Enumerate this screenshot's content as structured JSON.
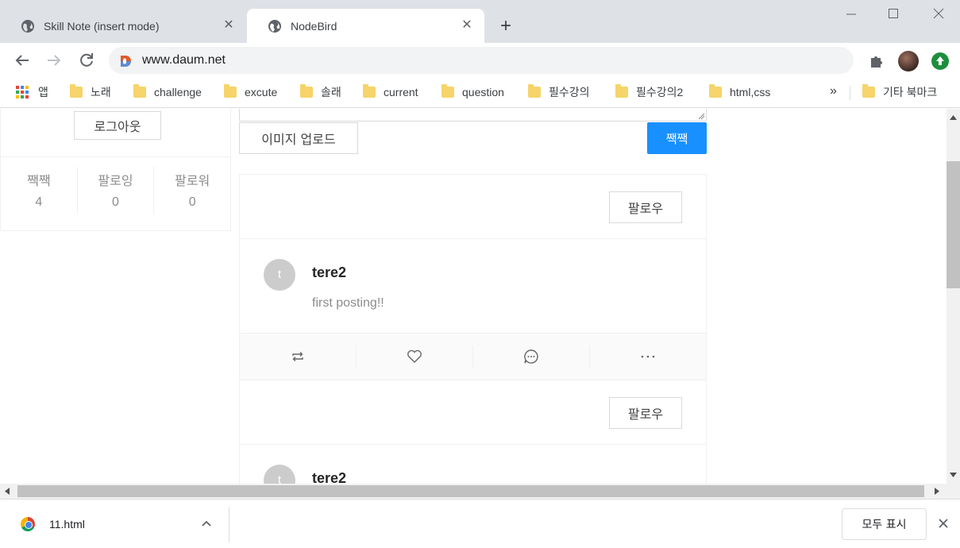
{
  "tabs": [
    {
      "title": "Skill Note (insert mode)",
      "active": false
    },
    {
      "title": "NodeBird",
      "active": true
    }
  ],
  "toolbar": {
    "url": "www.daum.net",
    "extension_icons": [
      "puzzle-icon",
      "profile-avatar",
      "update-icon"
    ]
  },
  "bookmarks": {
    "apps_label": "앱",
    "items": [
      "노래",
      "challenge",
      "excute",
      "솔래",
      "current",
      "question",
      "필수강의",
      "필수강의2",
      "html,css"
    ],
    "more": "»",
    "other": "기타 북마크"
  },
  "profile": {
    "logout_label": "로그아웃",
    "stats": [
      {
        "label": "짹짹",
        "value": "4"
      },
      {
        "label": "팔로잉",
        "value": "0"
      },
      {
        "label": "팔로워",
        "value": "0"
      }
    ]
  },
  "post_form": {
    "upload_label": "이미지 업로드",
    "submit_label": "짹짹"
  },
  "posts": [
    {
      "follow_label": "팔로우",
      "avatar_letter": "t",
      "author": "tere2",
      "content": "first posting!!"
    },
    {
      "follow_label": "팔로우",
      "avatar_letter": "t",
      "author": "tere2",
      "content": ""
    }
  ],
  "download_bar": {
    "filename": "11.html",
    "show_all_label": "모두 표시"
  },
  "colors": {
    "primary": "#1890ff",
    "tab_strip": "#dee1e6"
  }
}
